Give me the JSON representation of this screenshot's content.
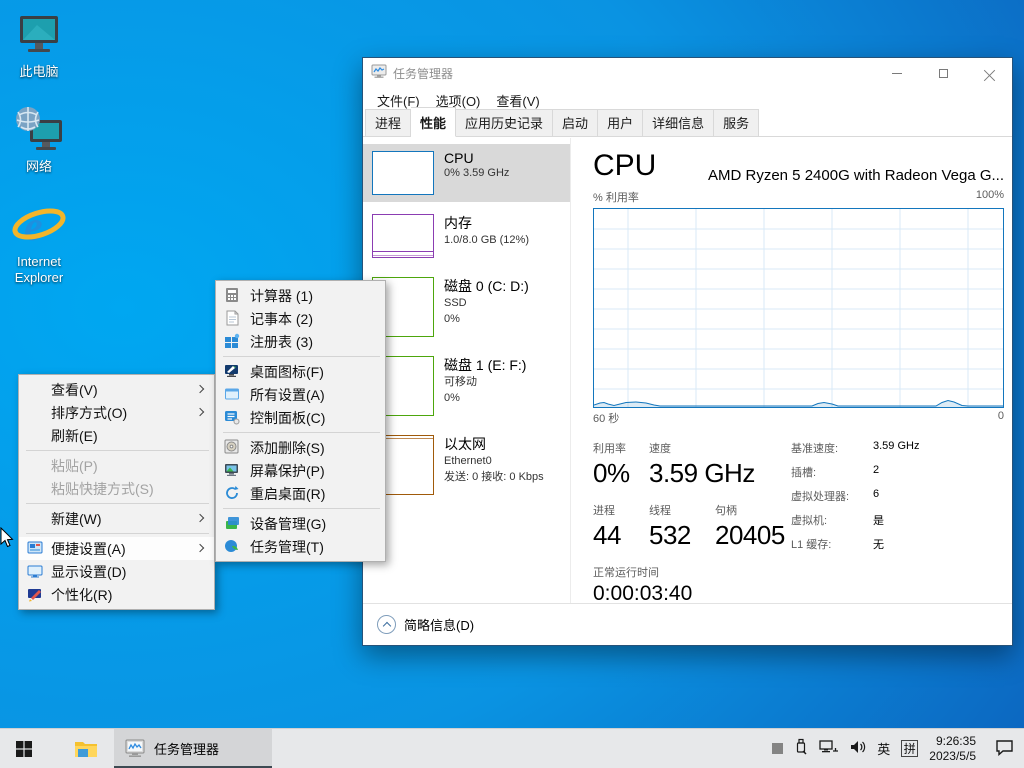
{
  "desktop": {
    "icons": [
      {
        "label": "此电脑"
      },
      {
        "label": "网络"
      },
      {
        "label": "Internet Explorer"
      }
    ]
  },
  "context_menu": {
    "items": [
      {
        "label": "查看(V)"
      },
      {
        "label": "排序方式(O)"
      },
      {
        "label": "刷新(E)"
      },
      {
        "label": "粘贴(P)"
      },
      {
        "label": "粘贴快捷方式(S)"
      },
      {
        "label": "新建(W)"
      },
      {
        "label": "便捷设置(A)"
      },
      {
        "label": "显示设置(D)"
      },
      {
        "label": "个性化(R)"
      }
    ]
  },
  "submenu": {
    "items": [
      {
        "label": "计算器 (1)"
      },
      {
        "label": "记事本 (2)"
      },
      {
        "label": "注册表 (3)"
      },
      {
        "label": "桌面图标(F)"
      },
      {
        "label": "所有设置(A)"
      },
      {
        "label": "控制面板(C)"
      },
      {
        "label": "添加删除(S)"
      },
      {
        "label": "屏幕保护(P)"
      },
      {
        "label": "重启桌面(R)"
      },
      {
        "label": "设备管理(G)"
      },
      {
        "label": "任务管理(T)"
      }
    ]
  },
  "taskmanager": {
    "title": "任务管理器",
    "menu": [
      "文件(F)",
      "选项(O)",
      "查看(V)"
    ],
    "tabs": [
      "进程",
      "性能",
      "应用历史记录",
      "启动",
      "用户",
      "详细信息",
      "服务"
    ],
    "sidebar": [
      {
        "title": "CPU",
        "line1": "0% 3.59 GHz",
        "color": "#1376bd"
      },
      {
        "title": "内存",
        "line1": "1.0/8.0 GB (12%)",
        "color": "#8b3db2"
      },
      {
        "title": "磁盘 0 (C: D:)",
        "line1": "SSD",
        "line2": "0%",
        "color": "#4da60c"
      },
      {
        "title": "磁盘 1 (E: F:)",
        "line1": "可移动",
        "line2": "0%",
        "color": "#4da60c"
      },
      {
        "title": "以太网",
        "line1": "Ethernet0",
        "line2": "发送: 0 接收: 0 Kbps",
        "color": "#a05a0a"
      }
    ],
    "main": {
      "cpu_title": "CPU",
      "cpu_device": "AMD Ryzen 5 2400G with Radeon Vega G...",
      "chart": {
        "ylabel": "% 利用率",
        "ymax_label": "100%",
        "xmin_label": "60 秒",
        "xmax_label": "0"
      },
      "stats": {
        "util_label": "利用率",
        "util": "0%",
        "speed_label": "速度",
        "speed": "3.59 GHz",
        "proc_label": "进程",
        "proc": "44",
        "thread_label": "线程",
        "thread": "532",
        "handle_label": "句柄",
        "handle": "20405",
        "uptime_label": "正常运行时间",
        "uptime": "0:00:03:40",
        "right_rows": [
          {
            "label": "基准速度:",
            "value": "3.59 GHz"
          },
          {
            "label": "插槽:",
            "value": "2"
          },
          {
            "label": "虚拟处理器:",
            "value": "6"
          },
          {
            "label": "虚拟机:",
            "value": "是"
          },
          {
            "label": "L1 缓存:",
            "value": "无"
          }
        ]
      },
      "footer": "简略信息(D)"
    }
  },
  "taskbar": {
    "app_label": "任务管理器",
    "ime_lang": "英",
    "ime_mode": "拼",
    "time": "9:26:35",
    "date": "2023/5/5"
  }
}
